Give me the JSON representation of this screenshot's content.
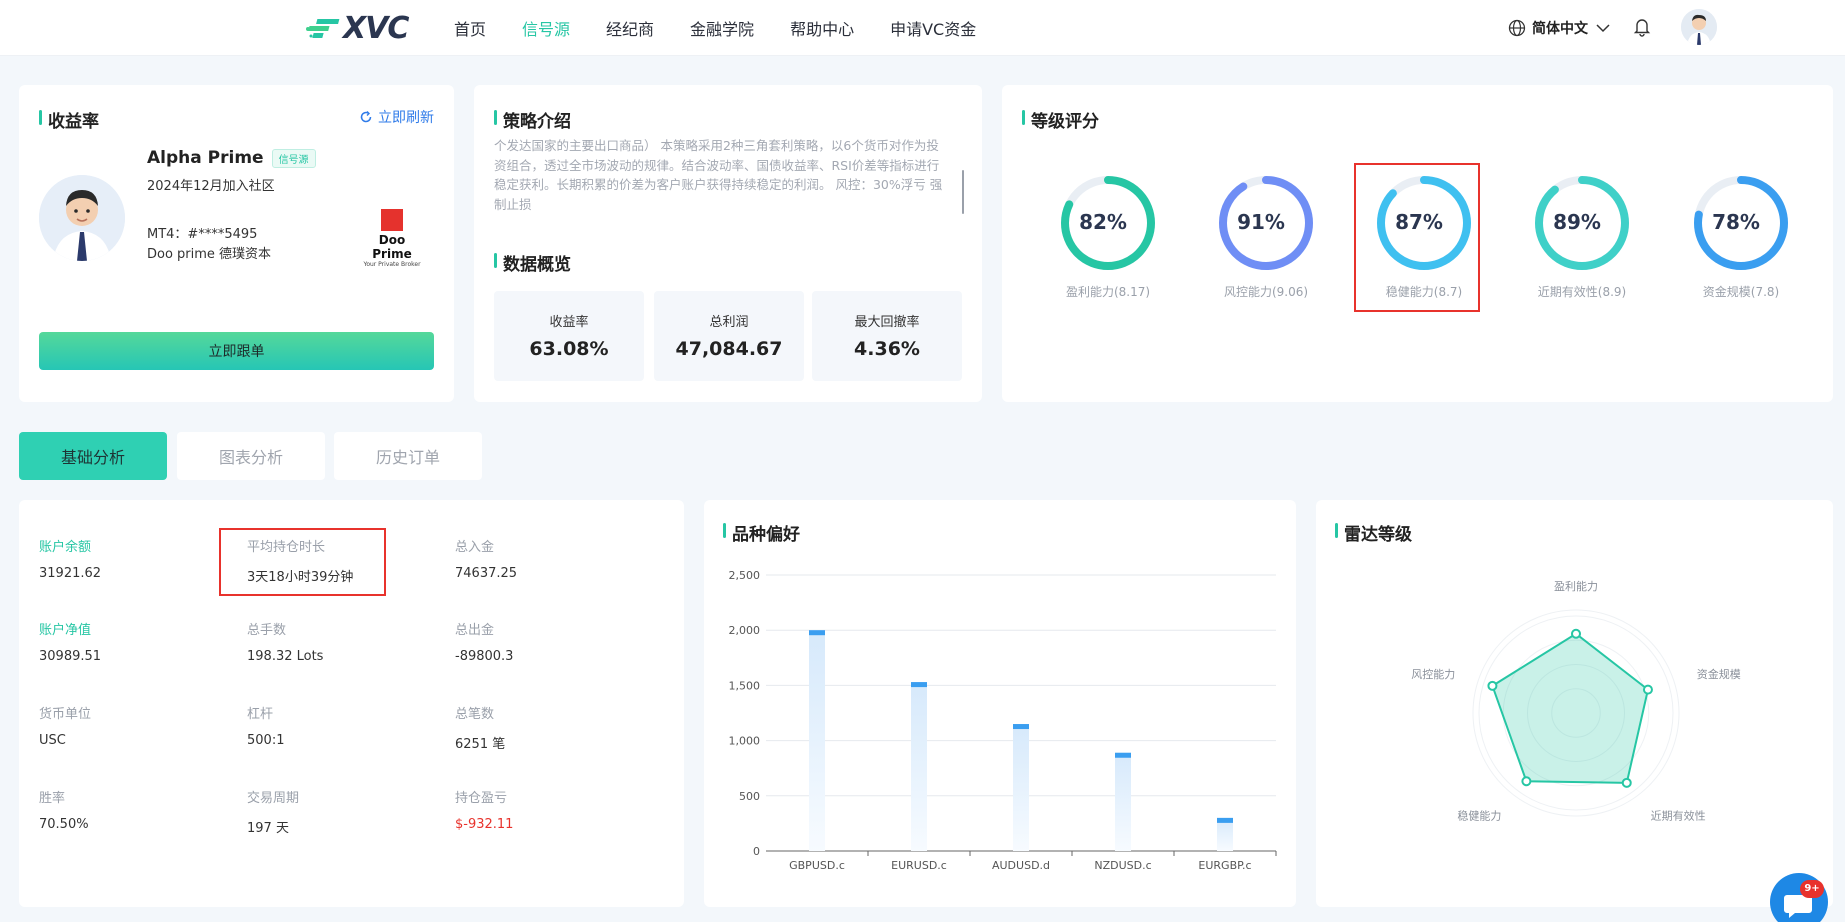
{
  "header": {
    "logo_text": "XVC",
    "nav": [
      "首页",
      "信号源",
      "经纪商",
      "金融学院",
      "帮助中心",
      "申请VC资金"
    ],
    "active_nav": "信号源",
    "language": "简体中文"
  },
  "profile_card": {
    "title": "收益率",
    "refresh_label": "立即刷新",
    "trader_name": "Alpha Prime",
    "badge": "信号源",
    "join_date": "2024年12月加入社区",
    "mt4": "MT4：#****5495",
    "broker": "Doo prime 德璞资本",
    "broker_logo_line1": "Doo Prime",
    "broker_logo_line2": "Your Private Broker",
    "follow_button": "立即跟单"
  },
  "strategy_card": {
    "title": "策略介绍",
    "description": "个发达国家的主要出口商品） 本策略采用2种三角套利策略，以6个货币对作为投资组合，透过全市场波动的规律。结合波动率、国债收益率、RSI价差等指标进行稳定获利。长期积累的价差为客户账户获得持续稳定的利润。 风控：30%浮亏 强制止损",
    "overview_title": "数据概览",
    "stats": [
      {
        "label": "收益率",
        "value": "63.08%"
      },
      {
        "label": "总利润",
        "value": "47,084.67"
      },
      {
        "label": "最大回撤率",
        "value": "4.36%"
      }
    ]
  },
  "rating_card": {
    "title": "等级评分",
    "gauges": [
      {
        "value_text": "82%",
        "percent": 82,
        "label": "盈利能力(8.17)",
        "color": "#26c6a4"
      },
      {
        "value_text": "91%",
        "percent": 91,
        "label": "风控能力(9.06)",
        "color": "#6f8ef5"
      },
      {
        "value_text": "87%",
        "percent": 87,
        "label": "稳健能力(8.7)",
        "color": "#3fc0f0"
      },
      {
        "value_text": "89%",
        "percent": 89,
        "label": "近期有效性(8.9)",
        "color": "#3fd0c8"
      },
      {
        "value_text": "78%",
        "percent": 78,
        "label": "资金规模(7.8)",
        "color": "#3a9ef0"
      }
    ]
  },
  "tabs": [
    "基础分析",
    "图表分析",
    "历史订单"
  ],
  "account": {
    "items": [
      {
        "label": "账户余额",
        "value": "31921.62"
      },
      {
        "label": "平均持仓时长",
        "value": "3天18小时39分钟"
      },
      {
        "label": "总入金",
        "value": "74637.25"
      },
      {
        "label": "账户净值",
        "value": "30989.51"
      },
      {
        "label": "总手数",
        "value": "198.32 Lots"
      },
      {
        "label": "总出金",
        "value": "-89800.3"
      },
      {
        "label": "货币单位",
        "value": "USC"
      },
      {
        "label": "杠杆",
        "value": "500:1"
      },
      {
        "label": "总笔数",
        "value": "6251 笔"
      },
      {
        "label": "胜率",
        "value": "70.50%"
      },
      {
        "label": "交易周期",
        "value": "197 天"
      },
      {
        "label": "持仓盈亏",
        "value": "$-932.11"
      }
    ]
  },
  "chart_card": {
    "title": "品种偏好"
  },
  "chart_data": [
    {
      "type": "bar",
      "title": "品种偏好",
      "categories": [
        "GBPUSD.c",
        "EURUSD.c",
        "AUDUSD.d",
        "NZDUSD.c",
        "EURGBP.c"
      ],
      "values": [
        2000,
        1530,
        1150,
        890,
        300
      ],
      "yticks": [
        "0",
        "500",
        "1,000",
        "1,500",
        "2,000",
        "2,500"
      ],
      "ylim": [
        0,
        2500
      ],
      "grid": true,
      "color": "#3a9ef0"
    },
    {
      "type": "radar",
      "title": "雷达等级",
      "indicators": [
        "盈利能力",
        "资金规模",
        "近期有效性",
        "稳健能力",
        "风控能力"
      ],
      "values": [
        8.17,
        7.8,
        8.9,
        8.7,
        9.06
      ],
      "max": 10,
      "color": "#26c6a4"
    }
  ],
  "radar_card": {
    "title": "雷达等级"
  },
  "chat": {
    "badge": "9+"
  }
}
